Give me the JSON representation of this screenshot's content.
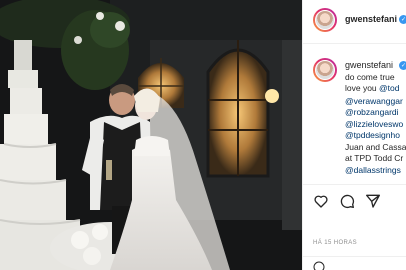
{
  "post": {
    "username": "gwenstefani",
    "verified_mark": "✓",
    "caption_lines": [
      {
        "text": "do come true ",
        "mention": ""
      },
      {
        "text": "love you ",
        "mention": "@tod"
      },
      {
        "text": "",
        "mention": "@verawanggar"
      },
      {
        "text": "",
        "mention": "@robzangardi"
      },
      {
        "text": "",
        "mention": "@lizzieloveswo"
      },
      {
        "text": "",
        "mention": "@tpddesignho"
      },
      {
        "text": "Juan and Cassa",
        "mention": ""
      },
      {
        "text": "at TPD Todd Cr",
        "mention": ""
      },
      {
        "text": "",
        "mention": "@dallasstrings"
      }
    ],
    "timestamp": "HÁ 15 HORAS"
  },
  "icons": {
    "like": "heart-icon",
    "comment": "comment-icon",
    "share": "share-icon",
    "emoji": "emoji-icon"
  },
  "colors": {
    "verified": "#3897f0",
    "mention": "#00376b",
    "text": "#262626",
    "muted": "#8e8e8e"
  }
}
